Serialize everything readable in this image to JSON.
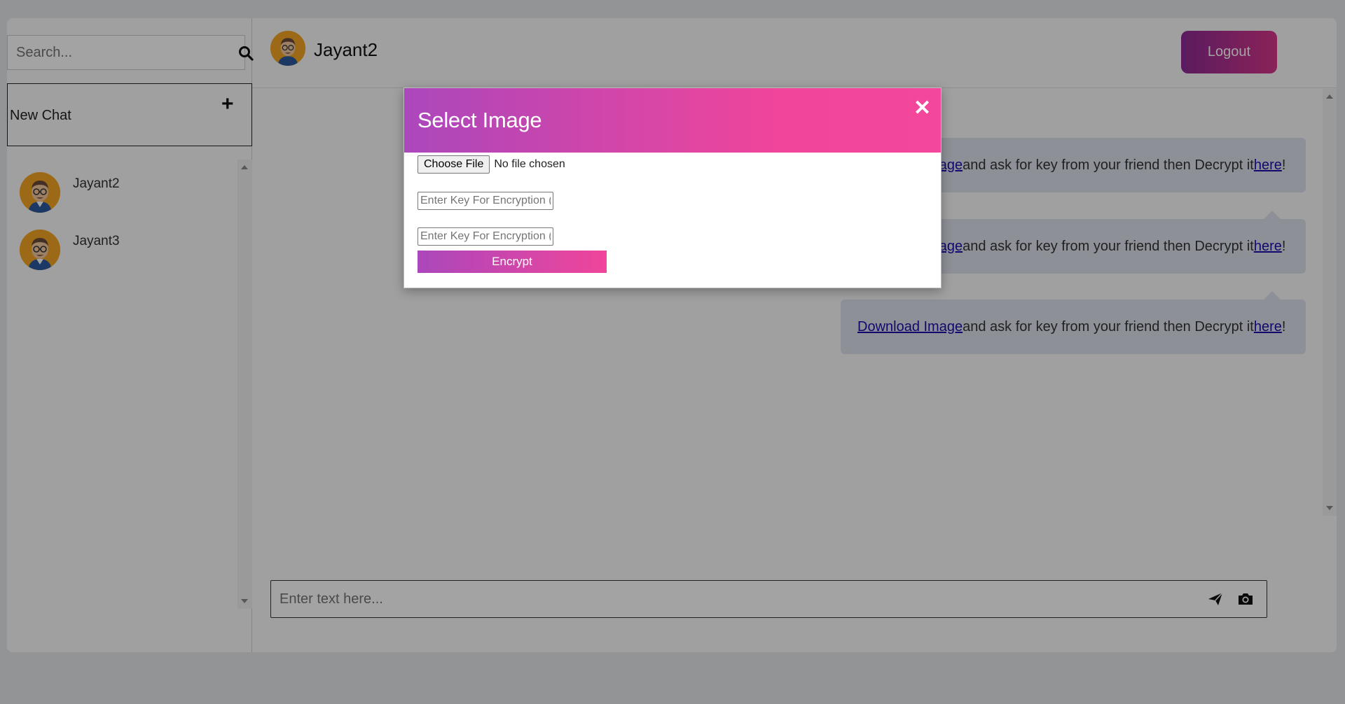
{
  "sidebar": {
    "search_placeholder": "Search...",
    "new_chat_label": "New Chat",
    "contacts": [
      {
        "name": "Jayant2"
      },
      {
        "name": "Jayant3"
      }
    ]
  },
  "header": {
    "contact_name": "Jayant2",
    "logout_label": "Logout"
  },
  "messages": [
    {
      "link_text": "Download Image ",
      "text": "and ask for key from your friend then Decrypt it ",
      "here_text": "here ",
      "suffix": "!"
    },
    {
      "link_text": "Download Image ",
      "text": "and ask for key from your friend then Decrypt it ",
      "here_text": "here ",
      "suffix": "!"
    },
    {
      "link_text": "Download Image ",
      "text": "and ask for key from your friend then Decrypt it ",
      "here_text": "here ",
      "suffix": "!"
    }
  ],
  "composer": {
    "placeholder": "Enter text here..."
  },
  "modal": {
    "title": "Select Image",
    "close_symbol": "✕",
    "choose_file_label": "Choose File",
    "file_status": "No file chosen",
    "key_placeholder_1": "Enter Key For Encryption (",
    "key_placeholder_2": "Enter Key For Encryption (",
    "encrypt_label": "Encrypt"
  },
  "colors": {
    "accent_start": "#ab47bc",
    "accent_end": "#f0459a",
    "link": "#1a0dab"
  }
}
